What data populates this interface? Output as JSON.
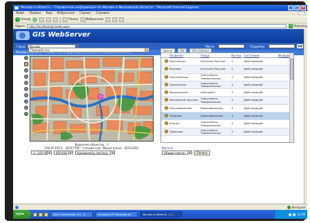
{
  "window": {
    "title": "Москва и область :: Справочная информация по Москве и Московской области :: Microsoft Internet Explorer"
  },
  "menubar": [
    "Файл",
    "Правка",
    "Вид",
    "Избранное",
    "Сервис",
    "Справка"
  ],
  "toolbar": {
    "back_label": "Назад",
    "search_label": "Поиск",
    "favorites_label": "Избранное"
  },
  "address": {
    "label": "Адрес",
    "url": "http://localhost/gisindex.aspx",
    "go_label": "Переход"
  },
  "app": {
    "title": "GIS WebServer",
    "city_label": "Город",
    "city_value": "Москва",
    "field2_label": "Места",
    "field3_label": "Подробно",
    "search_btn": "Найти"
  },
  "breadcrumb": "Москва и область :: Справочная информация по Москве и Московской области",
  "map": {
    "layer_select": "Перекрёстки",
    "objects_line": "Выделено объектов : 1",
    "coords_line": "E/N 45 035.6 : 36707790 : станция м.ф. (Mouse move) : 42153200",
    "scale_select": "1 : 100 000",
    "zoom_select": "400.000",
    "coord_select": "Координаты (метры)"
  },
  "tabs": [
    "Центр",
    "Kit",
    "Kit стоянки"
  ],
  "table": {
    "columns": [
      "Название",
      "Улица",
      "Кол-во",
      "Состояние",
      "Информация"
    ],
    "rows": [
      {
        "name": "Кантемская",
        "street": "Катукина Монская",
        "num": "3",
        "status": "Действующий",
        "selected": false
      },
      {
        "name": "Вилиева",
        "street": "Катукина Монская",
        "num": "2",
        "status": "Действующий",
        "selected": false
      },
      {
        "name": "Чертановская",
        "street": "Серпуховско-Тимирязевская",
        "num": "3",
        "status": "Действующий",
        "selected": false
      },
      {
        "name": "Пушкинская",
        "street": "Серпуховско-Тимирязевская",
        "num": "4",
        "status": "Действующий",
        "selected": false
      },
      {
        "name": "Маршальская",
        "street": "Кольцевая",
        "num": "3",
        "status": "Действующий",
        "selected": false
      },
      {
        "name": "Московский проспект",
        "street": "Серпуховско-Тимирязевская",
        "num": "4",
        "status": "Действующий",
        "selected": false
      },
      {
        "name": "Кантемировская",
        "street": "Замоскворецкая",
        "num": "4",
        "status": "Действующий",
        "selected": false
      },
      {
        "name": "Тверская",
        "street": "Замоскворецкая",
        "num": "3",
        "status": "Действующий",
        "selected": true
      },
      {
        "name": "Южная",
        "street": "Серпуховско-Тимирязевская",
        "num": "4",
        "status": "Действующий",
        "selected": false
      },
      {
        "name": "Пражская",
        "street": "Серпуховско-Тимирязевская",
        "num": "3",
        "status": "Действующий",
        "selected": false
      }
    ]
  },
  "filter": {
    "label": "Фильтр",
    "select_value": "Общий список",
    "button_label": "Печать"
  },
  "statusbar": {
    "zone_label": "Интернет"
  },
  "taskbar": {
    "start_label": "пуск",
    "tasks": [
      "Total Commander 6.0 - P...",
      "Windows XP Professional...",
      "Москва и область :: С..."
    ],
    "clock": "12:00"
  },
  "colors": {
    "gis_header": "#0a3a9a",
    "selected_row": "#b9d2ee",
    "map_building": "#e88a5a",
    "map_park": "#4e9a48",
    "map_water": "#2b6fc4"
  }
}
